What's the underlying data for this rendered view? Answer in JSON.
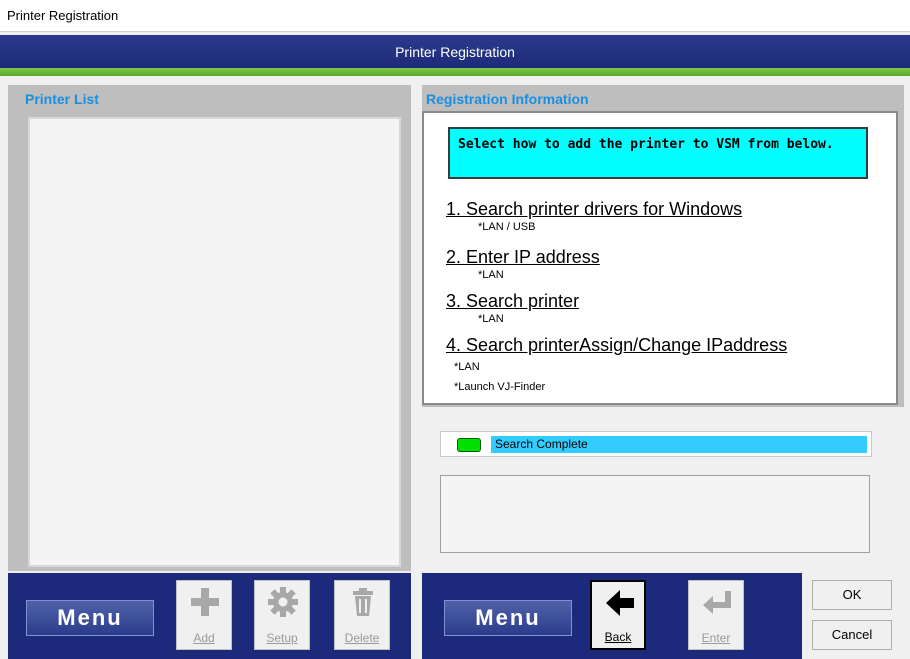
{
  "window": {
    "title": "Printer Registration"
  },
  "header": {
    "title": "Printer Registration"
  },
  "left_panel": {
    "title": "Printer List"
  },
  "right_panel": {
    "title": "Registration Information",
    "instruction": "Select how to add the printer to VSM from below.",
    "options": [
      {
        "label": "1. Search printer drivers for Windows",
        "notes": [
          "*LAN / USB"
        ]
      },
      {
        "label": "2. Enter IP address",
        "notes": [
          "*LAN"
        ]
      },
      {
        "label": "3. Search printer",
        "notes": [
          "*LAN"
        ]
      },
      {
        "label": "4. Search printerAssign/Change IPaddress",
        "notes": [
          "*LAN",
          "*Launch VJ-Finder"
        ]
      }
    ],
    "status_text": "Search Complete",
    "status_color": "#00e000"
  },
  "left_toolbar": {
    "menu_label": "Menu",
    "add_label": "Add",
    "setup_label": "Setup",
    "delete_label": "Delete"
  },
  "right_toolbar": {
    "menu_label": "Menu",
    "back_label": "Back",
    "enter_label": "Enter"
  },
  "dialog_buttons": {
    "ok_label": "OK",
    "cancel_label": "Cancel"
  },
  "colors": {
    "accent_blue": "#1d2a7c",
    "title_blue": "#1a8fe0",
    "highlight_cyan": "#00ffff",
    "status_bar": "#33ccff",
    "green_stripe": "#6fbe3a"
  },
  "icons": [
    "plus-icon",
    "gear-icon",
    "trash-icon",
    "back-arrow-icon",
    "enter-arrow-icon",
    "status-led-icon"
  ]
}
